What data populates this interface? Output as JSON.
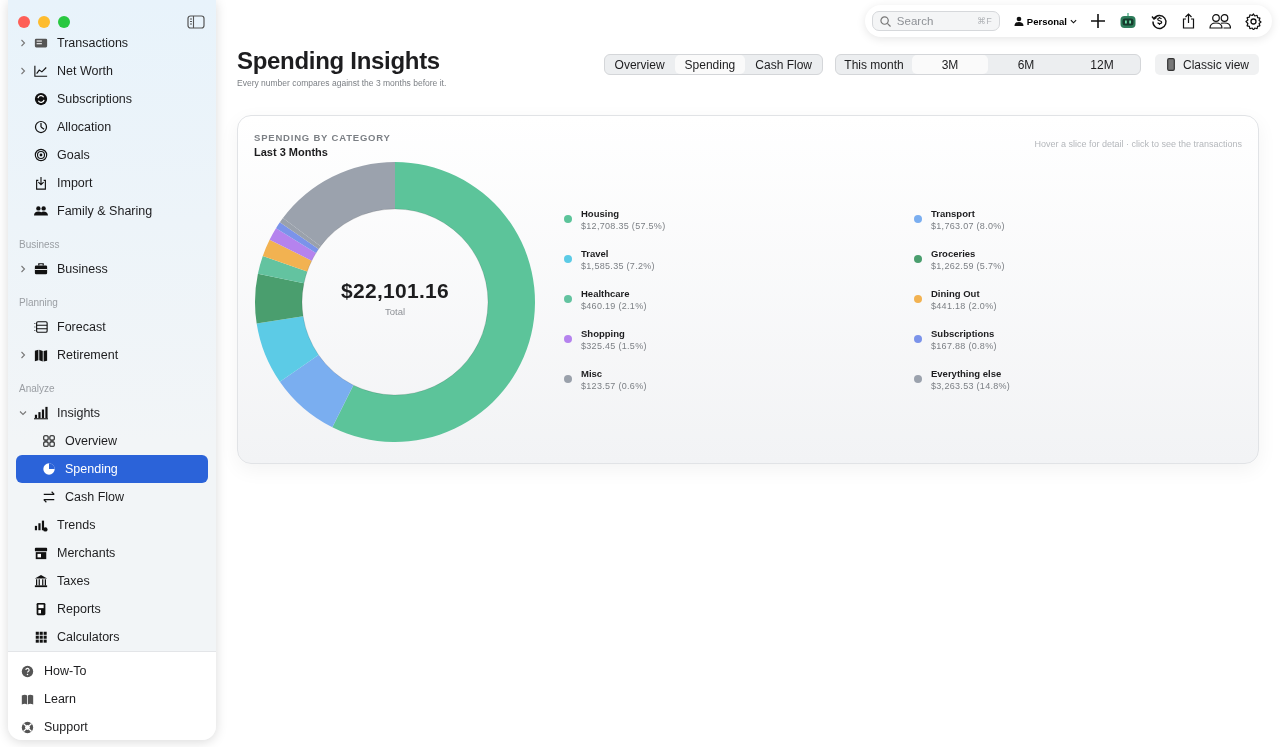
{
  "sidebar": {
    "items": [
      {
        "kind": "item",
        "label": "Transactions",
        "expanded": false
      },
      {
        "kind": "item",
        "label": "Net Worth",
        "expanded": false
      },
      {
        "kind": "item",
        "label": "Subscriptions"
      },
      {
        "kind": "item",
        "label": "Allocation"
      },
      {
        "kind": "item",
        "label": "Goals"
      },
      {
        "kind": "item",
        "label": "Import"
      },
      {
        "kind": "item",
        "label": "Family & Sharing"
      },
      {
        "kind": "header",
        "label": "Business"
      },
      {
        "kind": "item",
        "label": "Business",
        "expanded": false
      },
      {
        "kind": "header",
        "label": "Planning"
      },
      {
        "kind": "item",
        "label": "Forecast"
      },
      {
        "kind": "item",
        "label": "Retirement",
        "expanded": false
      },
      {
        "kind": "header",
        "label": "Analyze"
      },
      {
        "kind": "item",
        "label": "Insights",
        "expanded": true,
        "children": [
          {
            "label": "Overview",
            "selected": false
          },
          {
            "label": "Spending",
            "selected": true
          },
          {
            "label": "Cash Flow",
            "selected": false
          }
        ]
      },
      {
        "kind": "item",
        "label": "Trends"
      },
      {
        "kind": "item",
        "label": "Merchants"
      },
      {
        "kind": "item",
        "label": "Taxes"
      },
      {
        "kind": "item",
        "label": "Reports"
      },
      {
        "kind": "item",
        "label": "Calculators"
      }
    ],
    "footer": [
      "How-To",
      "Learn",
      "Support"
    ]
  },
  "toolbar": {
    "search": {
      "placeholder": "Search",
      "shortcut": "⌘F"
    },
    "profile": "Personal"
  },
  "header": {
    "title": "Spending Insights",
    "subtitle": "Every number compares against the 3 months before it.",
    "view_tabs": [
      {
        "label": "Overview",
        "selected": false
      },
      {
        "label": "Spending",
        "selected": true
      },
      {
        "label": "Cash Flow",
        "selected": false
      }
    ],
    "range_tabs": [
      {
        "label": "This month",
        "selected": false
      },
      {
        "label": "3M",
        "selected": true
      },
      {
        "label": "6M",
        "selected": false
      },
      {
        "label": "12M",
        "selected": false
      }
    ],
    "classic_button": "Classic view"
  },
  "card": {
    "eyebrow": "SPENDING BY CATEGORY",
    "title": "Last 3 Months",
    "hint": "Hover a slice for detail · click to see the transactions",
    "total": "$22,101.16",
    "total_label": "Total",
    "chart_data": {
      "type": "donut",
      "categories": [
        "Housing",
        "Transport",
        "Travel",
        "Groceries",
        "Healthcare",
        "Dining Out",
        "Shopping",
        "Subscriptions",
        "Misc",
        "Everything else"
      ],
      "values": [
        57.5,
        8.0,
        7.2,
        5.7,
        2.1,
        2.0,
        1.5,
        0.8,
        0.6,
        14.8
      ],
      "value_labels": [
        "$12,708.35 (57.5%)",
        "$1,763.07 (8.0%)",
        "$1,585.35 (7.2%)",
        "$1,262.59 (5.7%)",
        "$460.19 (2.1%)",
        "$441.18 (2.0%)",
        "$325.45 (1.5%)",
        "$167.88 (0.8%)",
        "$123.57 (0.6%)",
        "$3,263.53 (14.8%)"
      ]
    },
    "legend": [
      {
        "color": "#5cc49a"
      },
      {
        "color": "#7aaef0"
      },
      {
        "color": "#5ccbe6"
      },
      {
        "color": "#4a9e6e"
      },
      {
        "color": "#63c3a0"
      },
      {
        "color": "#f2b251"
      },
      {
        "color": "#b583ee"
      },
      {
        "color": "#7b93ea"
      },
      {
        "color": "#9aa1ab"
      },
      {
        "color": "#9ba2ad"
      }
    ]
  }
}
